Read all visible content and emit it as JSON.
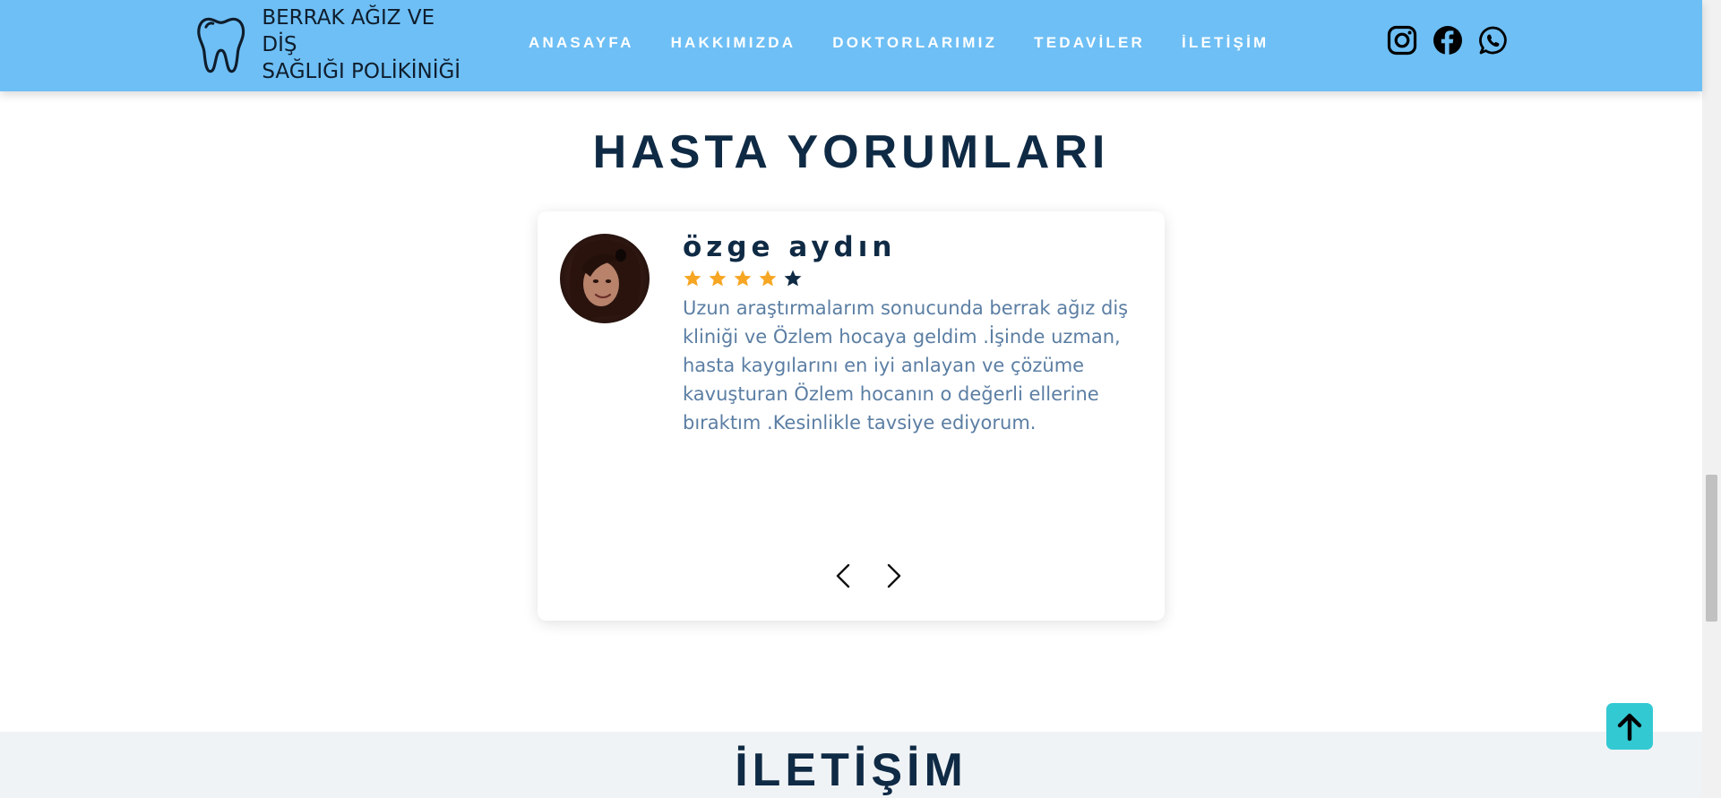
{
  "header": {
    "logo_text_line1": "BERRAK AĞIZ VE DİŞ",
    "logo_text_line2": "SAĞLIĞI POLİKİNİĞİ",
    "nav": [
      {
        "label": "ANASAYFA"
      },
      {
        "label": "HAKKIMIZDA"
      },
      {
        "label": "DOKTORLARIMIZ"
      },
      {
        "label": "TEDAVİLER"
      },
      {
        "label": "İLETİŞİM"
      }
    ],
    "social": [
      "instagram-icon",
      "facebook-icon",
      "whatsapp-icon"
    ]
  },
  "testimonials": {
    "title": "HASTA YORUMLARI",
    "review": {
      "name": "özge aydın",
      "rating": 4,
      "rating_max": 5,
      "text": "Uzun araştırmalarım sonucunda berrak ağız diş kliniği ve Özlem hocaya geldim .İşinde uzman, hasta kaygılarını en iyi anlayan ve çözüme kavuşturan Özlem hocanın o değerli ellerine bıraktım .Kesinlikle tavsiye ediyorum."
    },
    "prev_icon": "chevron-left-icon",
    "next_icon": "chevron-right-icon"
  },
  "contact": {
    "title": "İLETİŞİM"
  },
  "colors": {
    "header_bg": "#6ebff5",
    "title": "#0f2a44",
    "review_text": "#5b7ea3",
    "star_filled": "#f6a623",
    "star_empty": "#0f2a44",
    "to_top_bg": "#33c9d3"
  }
}
